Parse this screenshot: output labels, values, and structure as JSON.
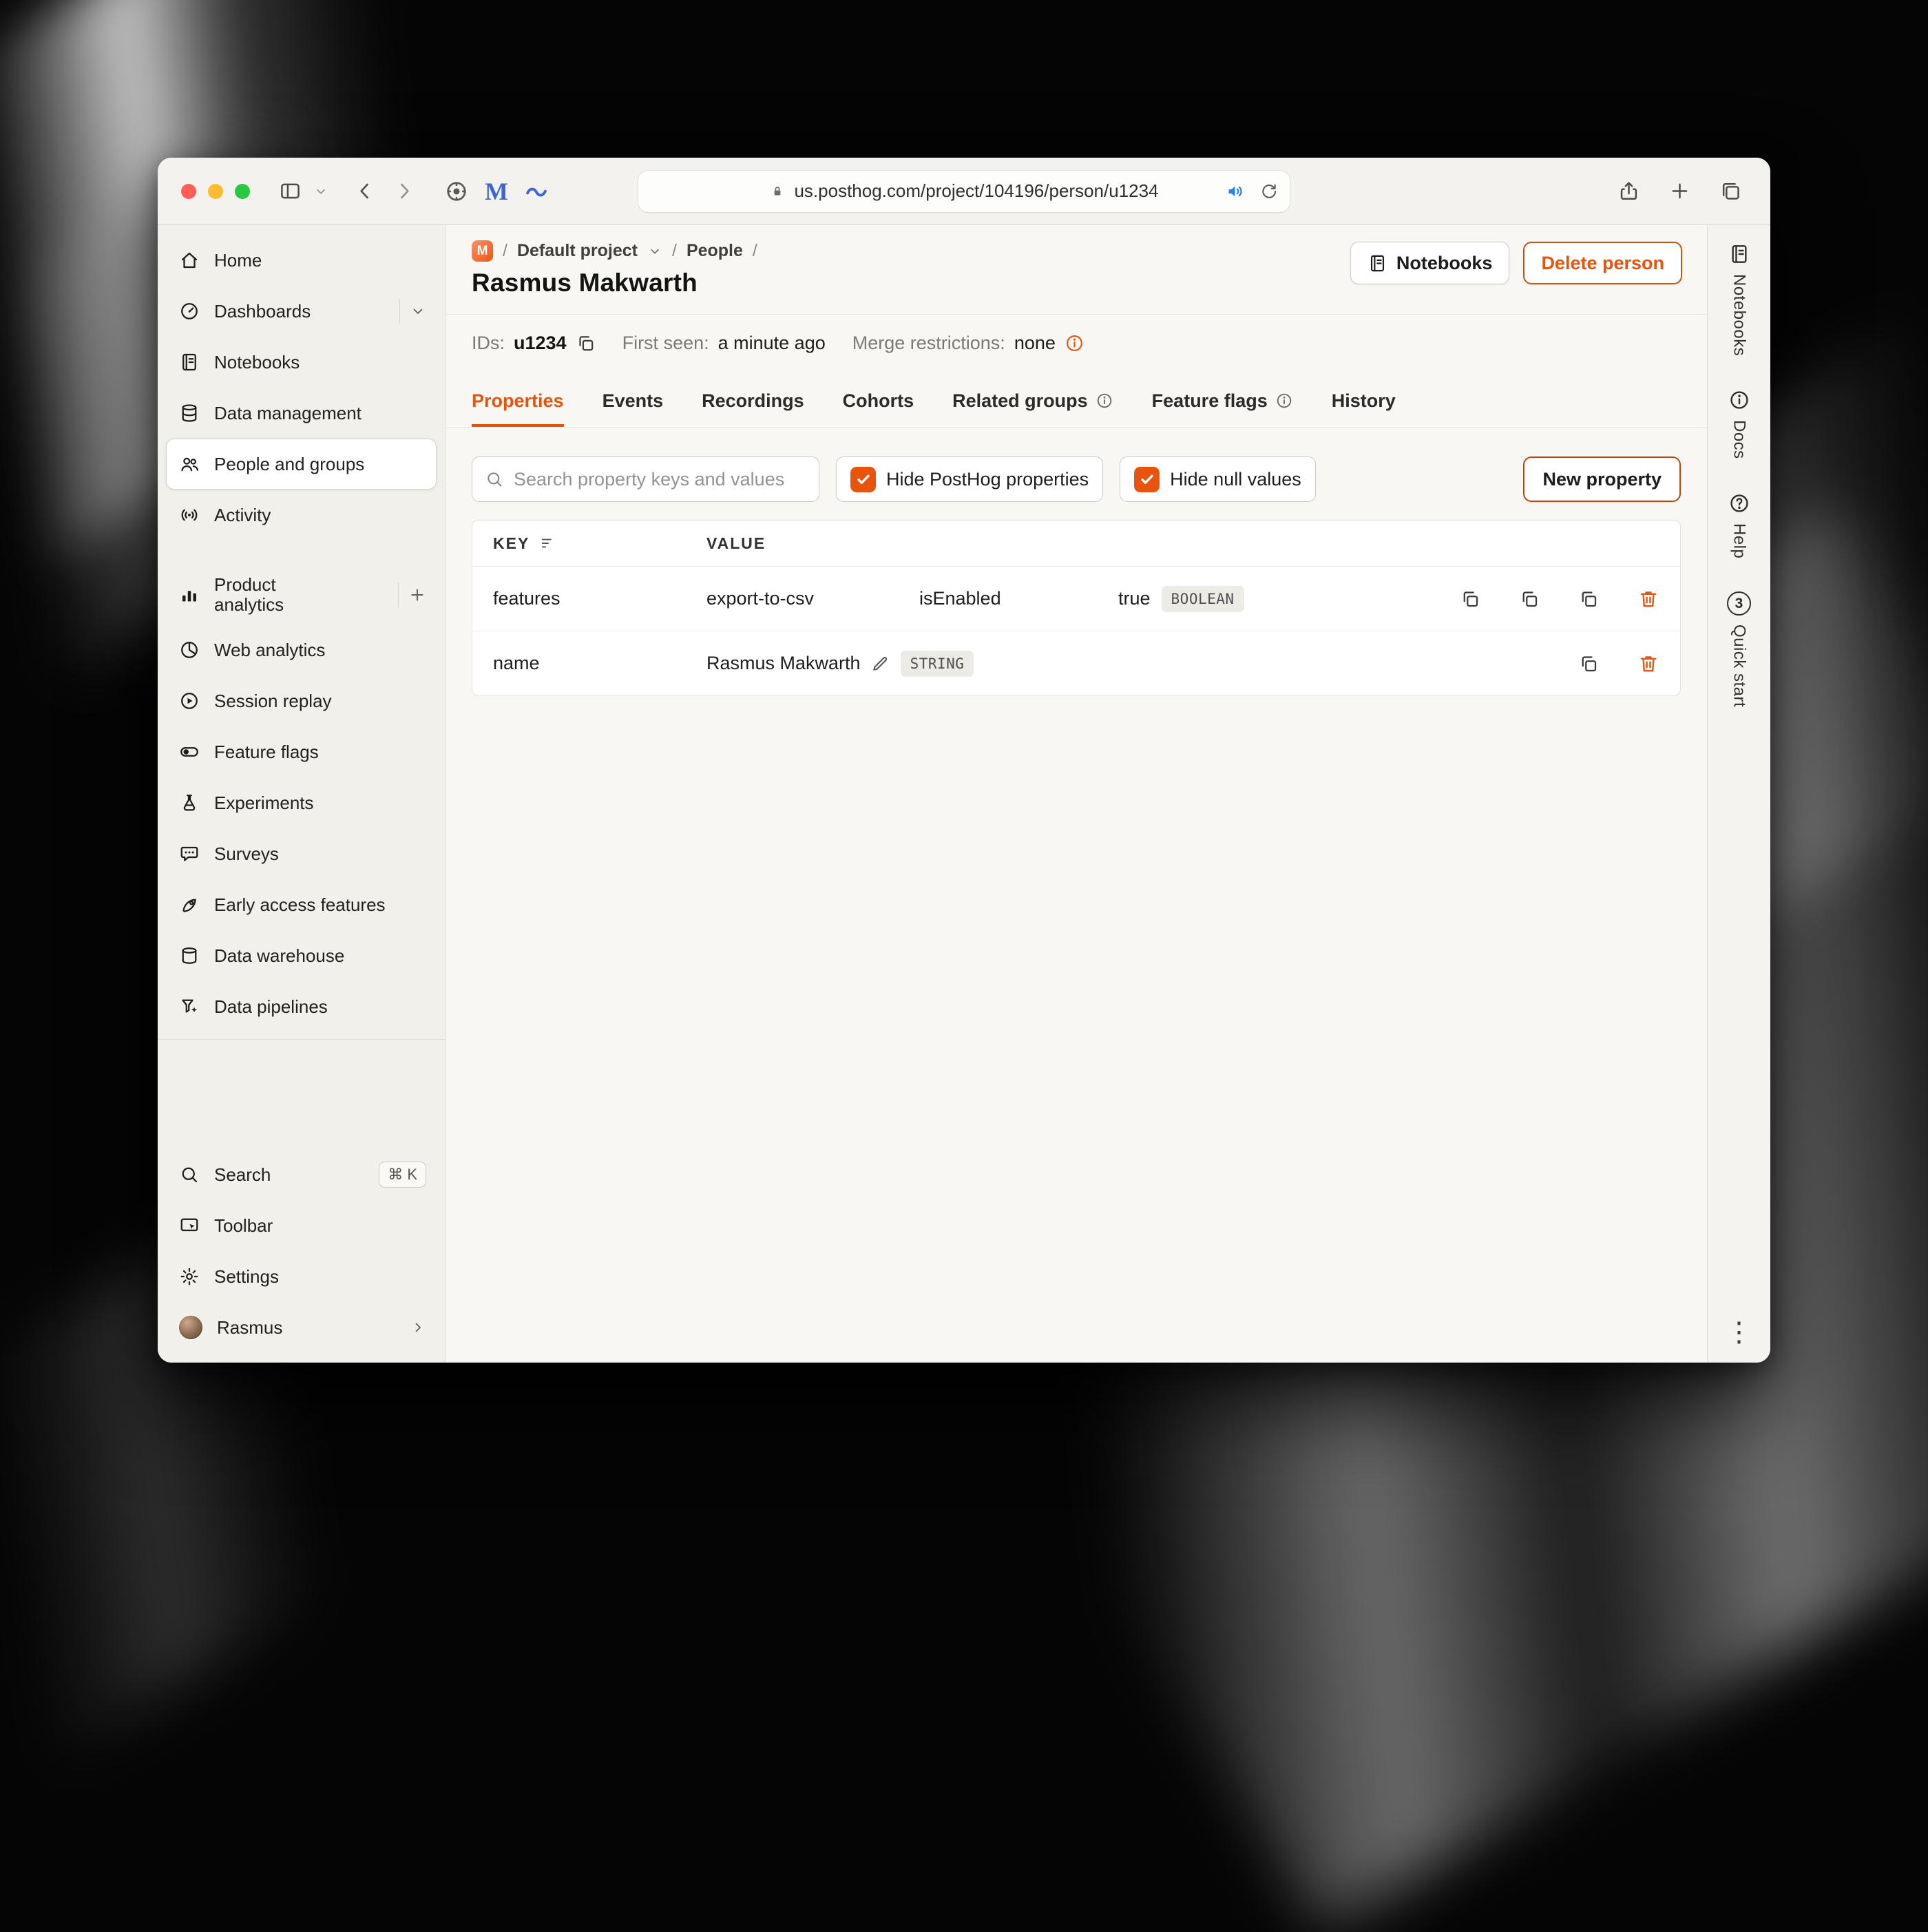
{
  "colors": {
    "accent": "#e8540e",
    "traffic_red": "#ff5f57",
    "traffic_yellow": "#febc2e",
    "traffic_green": "#28c840"
  },
  "browser": {
    "url": "us.posthog.com/project/104196/person/u1234"
  },
  "sidebar": {
    "items": [
      {
        "label": "Home",
        "icon": "home"
      },
      {
        "label": "Dashboards",
        "icon": "dashboard-gauge"
      },
      {
        "label": "Notebooks",
        "icon": "notebook"
      },
      {
        "label": "Data management",
        "icon": "database"
      },
      {
        "label": "People and groups",
        "icon": "people",
        "selected": true
      },
      {
        "label": "Activity",
        "icon": "broadcast"
      },
      {
        "label": "Product analytics",
        "icon": "bar-chart"
      },
      {
        "label": "Web analytics",
        "icon": "pie-chart"
      },
      {
        "label": "Session replay",
        "icon": "play-circle"
      },
      {
        "label": "Feature flags",
        "icon": "toggle"
      },
      {
        "label": "Experiments",
        "icon": "flask"
      },
      {
        "label": "Surveys",
        "icon": "speech-bubble"
      },
      {
        "label": "Early access features",
        "icon": "rocket"
      },
      {
        "label": "Data warehouse",
        "icon": "warehouse"
      },
      {
        "label": "Data pipelines",
        "icon": "pipeline"
      }
    ],
    "footer": [
      {
        "label": "Search",
        "icon": "magnifier",
        "shortcut": "⌘ K"
      },
      {
        "label": "Toolbar",
        "icon": "toolbar-window"
      },
      {
        "label": "Settings",
        "icon": "gear"
      },
      {
        "label": "Rasmus",
        "icon": "avatar"
      }
    ]
  },
  "header": {
    "breadcrumb": {
      "org_initial": "M",
      "project": "Default project",
      "section": "People"
    },
    "title": "Rasmus Makwarth",
    "notebooks_button": "Notebooks",
    "delete_button": "Delete person"
  },
  "meta": {
    "ids_label": "IDs:",
    "id_value": "u1234",
    "first_seen_label": "First seen:",
    "first_seen_value": "a minute ago",
    "merge_label": "Merge restrictions:",
    "merge_value": "none"
  },
  "tabs": [
    {
      "label": "Properties",
      "active": true
    },
    {
      "label": "Events"
    },
    {
      "label": "Recordings"
    },
    {
      "label": "Cohorts"
    },
    {
      "label": "Related groups",
      "info": true
    },
    {
      "label": "Feature flags",
      "info": true
    },
    {
      "label": "History"
    }
  ],
  "filters": {
    "search_placeholder": "Search property keys and values",
    "hide_posthog": "Hide PostHog properties",
    "hide_null": "Hide null values",
    "new_property": "New property"
  },
  "table": {
    "key_header": "KEY",
    "value_header": "VALUE",
    "rows": [
      {
        "key": "features",
        "seg1": "export-to-csv",
        "seg2": "isEnabled",
        "seg3": "true",
        "type": "BOOLEAN"
      },
      {
        "key": "name",
        "value": "Rasmus Makwarth",
        "type": "STRING"
      }
    ]
  },
  "rail": {
    "items": [
      {
        "label": "Notebooks",
        "icon": "notebook"
      },
      {
        "label": "Docs",
        "icon": "info-circle"
      },
      {
        "label": "Help",
        "icon": "help-circle"
      },
      {
        "label": "Quick start",
        "badge": "3"
      }
    ]
  }
}
